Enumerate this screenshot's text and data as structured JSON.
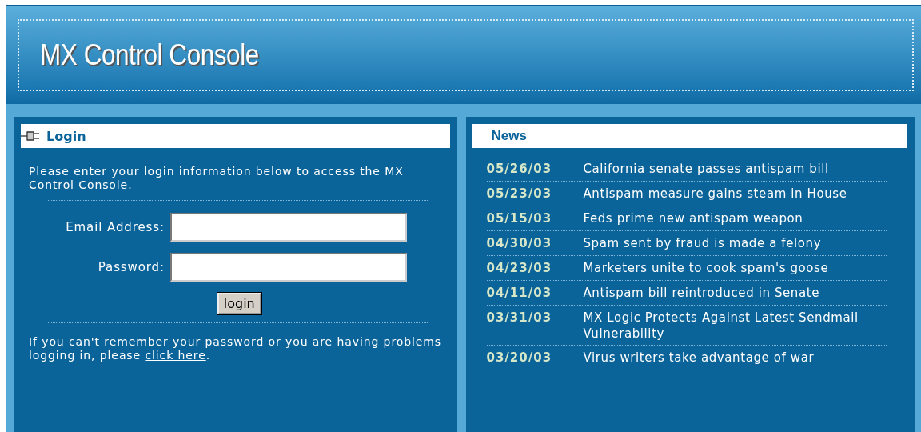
{
  "header": {
    "title": "MX Control Console"
  },
  "login": {
    "title": "Login",
    "intro": "Please enter your login information below to access the MX Control Console.",
    "fields": [
      {
        "label": "Email Address:"
      },
      {
        "label": "Password:"
      }
    ],
    "button": "login",
    "help": {
      "text": "If you can't remember your password or you are having problems logging in, please ",
      "link": "click here",
      "suffix": "."
    }
  },
  "news": {
    "title": "News",
    "items": [
      {
        "date": "05/26/03",
        "headline": "California senate passes antispam bill"
      },
      {
        "date": "05/23/03",
        "headline": "Antispam measure gains steam in House"
      },
      {
        "date": "05/15/03",
        "headline": "Feds prime new antispam weapon"
      },
      {
        "date": "04/30/03",
        "headline": "Spam sent by fraud is made a felony"
      },
      {
        "date": "04/23/03",
        "headline": "Marketers unite to cook spam's goose"
      },
      {
        "date": "04/11/03",
        "headline": "Antispam bill reintroduced in Senate"
      },
      {
        "date": "03/31/03",
        "headline": "MX Logic Protects Against Latest Sendmail Vulnerability"
      },
      {
        "date": "03/20/03",
        "headline": "Virus writers take advantage of war"
      }
    ]
  }
}
